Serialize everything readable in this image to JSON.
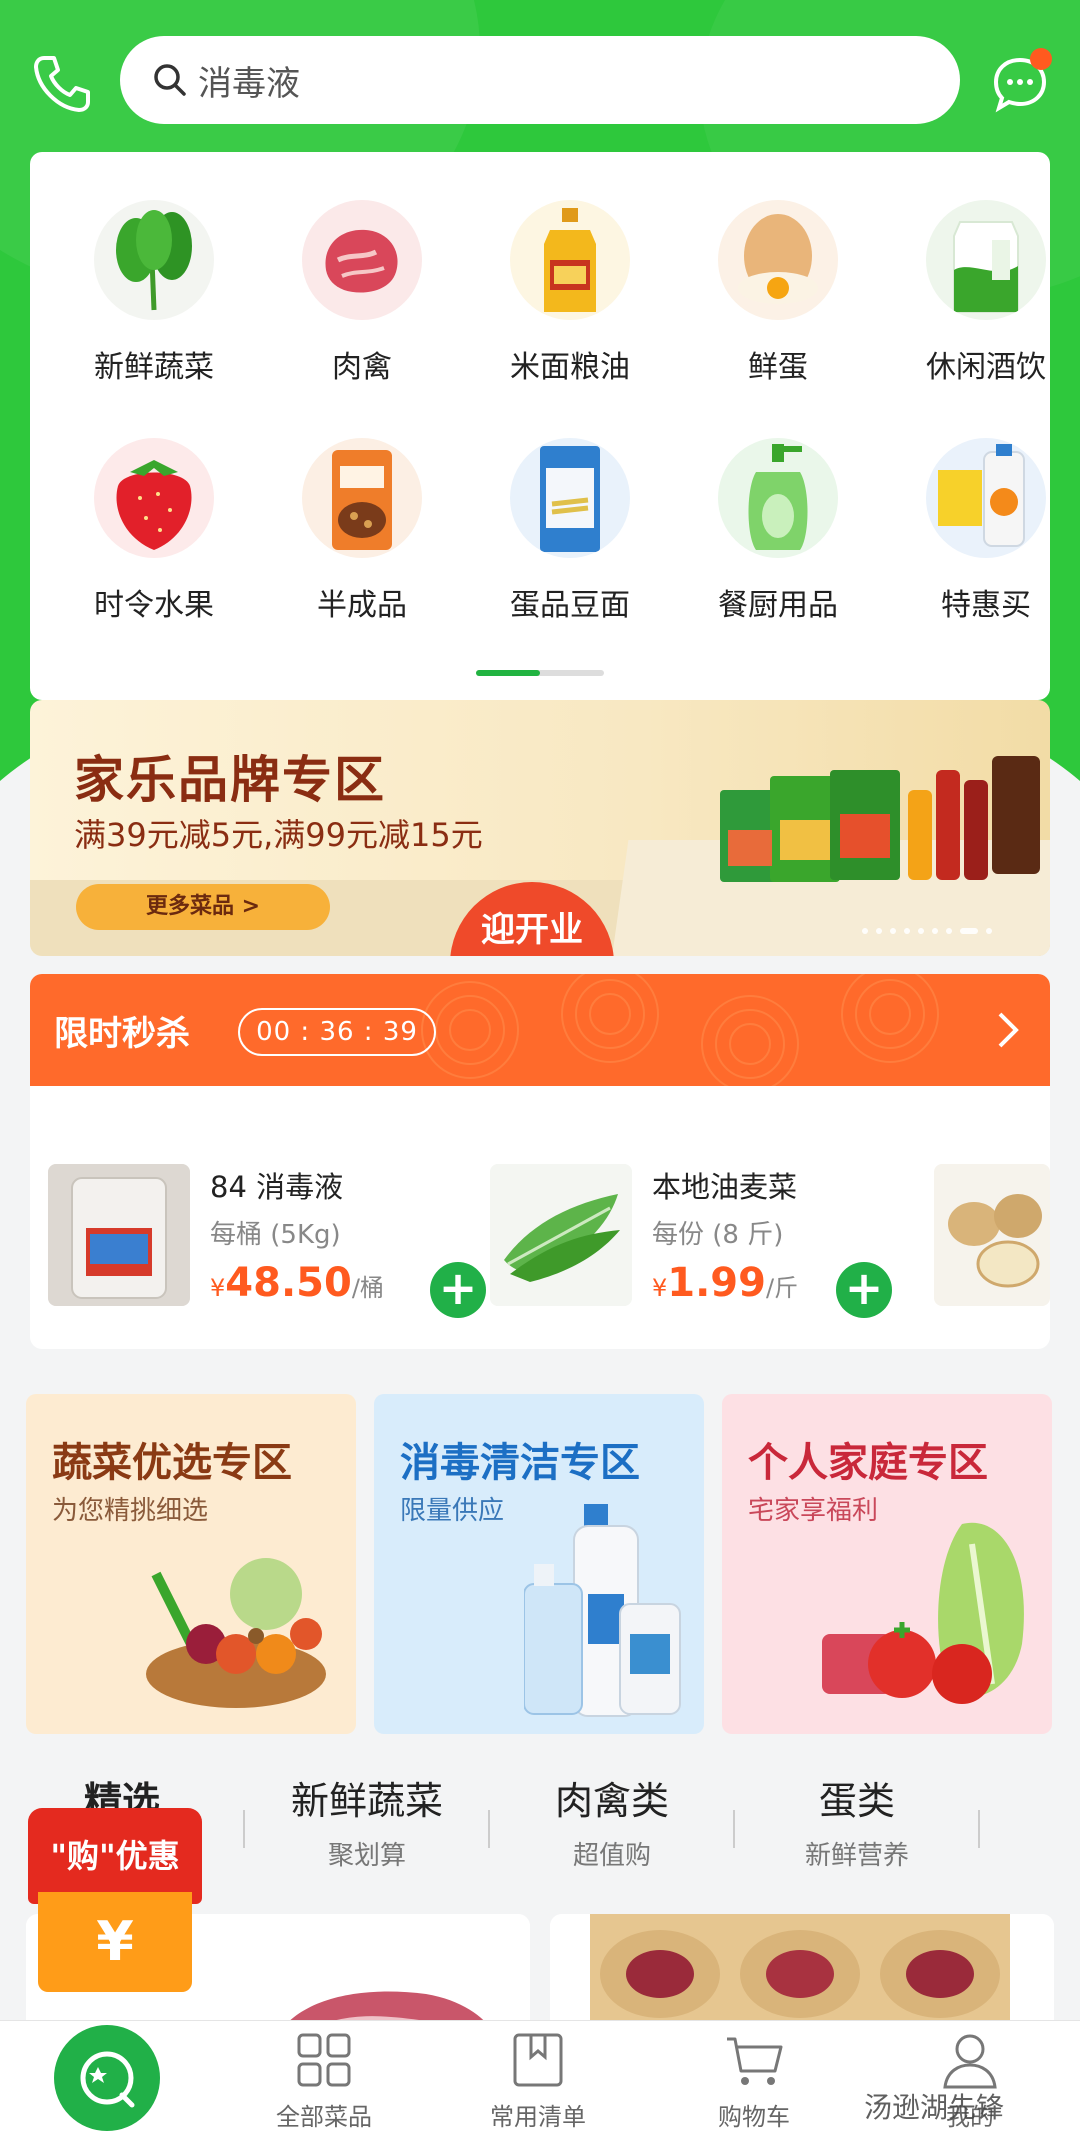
{
  "search": {
    "placeholder": "消毒液"
  },
  "categories": [
    {
      "label": "新鲜蔬菜",
      "icon": "vegetable-icon"
    },
    {
      "label": "肉禽",
      "icon": "meat-icon"
    },
    {
      "label": "米面粮油",
      "icon": "oil-icon"
    },
    {
      "label": "鲜蛋",
      "icon": "egg-icon"
    },
    {
      "label": "休闲酒饮",
      "icon": "milk-icon"
    },
    {
      "label": "时令水果",
      "icon": "strawberry-icon"
    },
    {
      "label": "半成品",
      "icon": "prepared-food-icon"
    },
    {
      "label": "蛋品豆面",
      "icon": "noodle-icon"
    },
    {
      "label": "餐厨用品",
      "icon": "dish-soap-icon"
    },
    {
      "label": "特惠买",
      "icon": "detergent-icon"
    }
  ],
  "banner": {
    "title": "家乐品牌专区",
    "subtitle": "满39元减5元,满99元减15元",
    "more_label": "更多菜品 >",
    "badge": "迎开业"
  },
  "flash_sale": {
    "title": "限时秒杀",
    "timer": "00 : 36 : 39",
    "products": [
      {
        "name": "84 消毒液",
        "unit": "每桶 (5Kg)",
        "currency": "¥",
        "price": "48.50",
        "per": "/桶"
      },
      {
        "name": "本地油麦菜",
        "unit": "每份 (8 斤)",
        "currency": "¥",
        "price": "1.99",
        "per": "/斤"
      }
    ]
  },
  "zones": [
    {
      "title": "蔬菜优选专区",
      "subtitle": "为您精挑细选",
      "bg": "#fdebd1",
      "title_color": "#8a3a14",
      "sub_color": "#8a5a3a"
    },
    {
      "title": "消毒清洁专区",
      "subtitle": "限量供应",
      "bg": "#d8ecfb",
      "title_color": "#1c6fc4",
      "sub_color": "#3a78b8"
    },
    {
      "title": "个人家庭专区",
      "subtitle": "宅家享福利",
      "bg": "#fde0e4",
      "title_color": "#c9283a",
      "sub_color": "#c9485a"
    }
  ],
  "tabs": [
    {
      "label": "精选",
      "sub": ""
    },
    {
      "label": "新鲜蔬菜",
      "sub": "聚划算"
    },
    {
      "label": "肉禽类",
      "sub": "超值购"
    },
    {
      "label": "蛋类",
      "sub": "新鲜营养"
    }
  ],
  "coupon": {
    "top": "\"购\"优惠",
    "symbol": "¥"
  },
  "nav": [
    {
      "label": "全部菜品",
      "icon": "grid-icon"
    },
    {
      "label": "常用清单",
      "icon": "bookmark-icon"
    },
    {
      "label": "购物车",
      "icon": "cart-icon"
    },
    {
      "label": "我的",
      "icon": "user-icon"
    }
  ],
  "watermark": "汤逊湖先锋",
  "colors": {
    "brand_green": "#2ec83c",
    "flash_orange": "#ff6a2b",
    "price_orange": "#ff5a1f"
  }
}
